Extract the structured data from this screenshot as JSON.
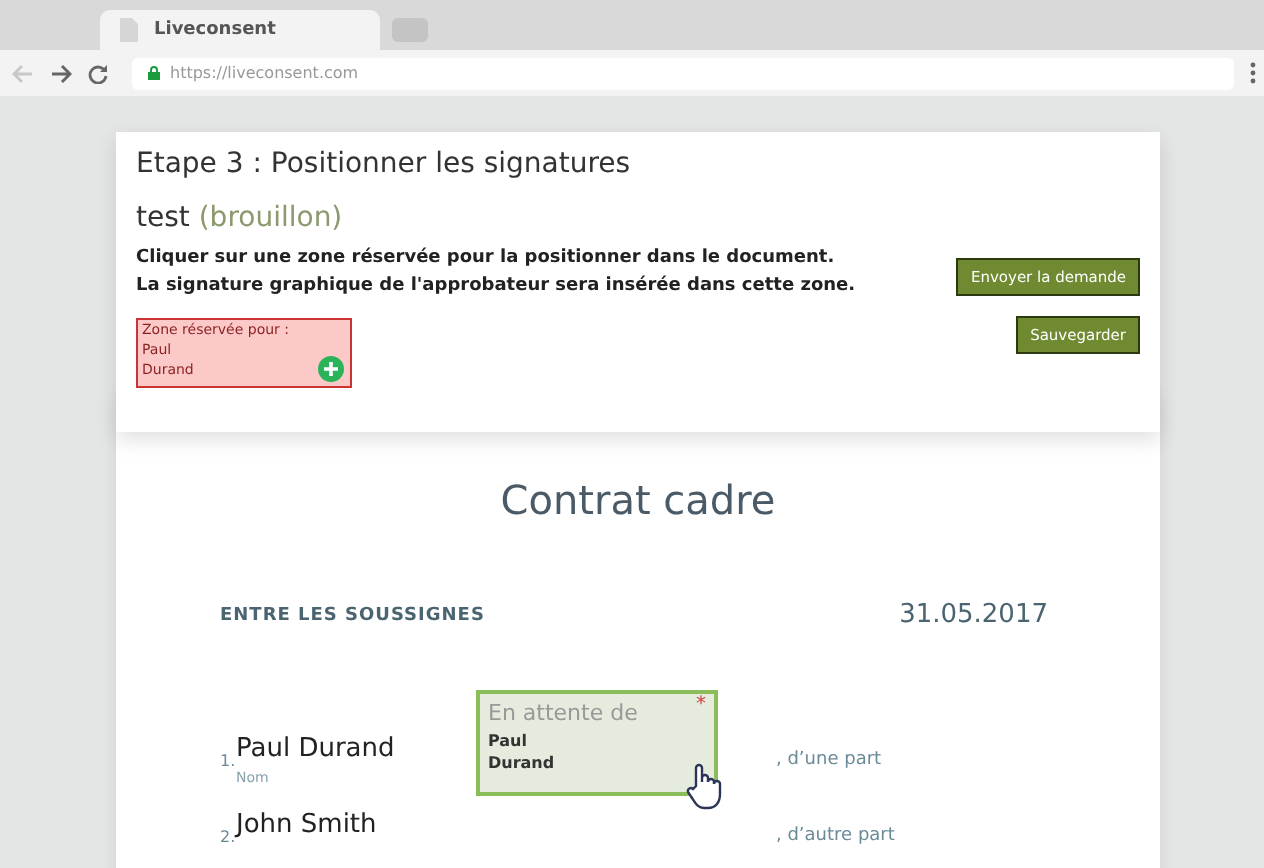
{
  "browser": {
    "tab_title": "Liveconsent",
    "url": "https://liveconsent.com"
  },
  "panel": {
    "title": "Etape 3 : Positionner les signatures",
    "doc_name": "test",
    "status": "(brouillon)",
    "instructions": [
      "Cliquer sur une zone réservée pour la positionner dans le document.",
      "La signature graphique de l'approbateur sera insérée dans cette zone."
    ],
    "zone": {
      "label": "Zone réservée pour :",
      "first_name": "Paul",
      "last_name": "Durand"
    },
    "buttons": [
      "Envoyer la demande",
      "Sauvegarder"
    ]
  },
  "document": {
    "title": "Contrat cadre",
    "section": "ENTRE LES SOUSSIGNES",
    "date": "31.05.2017",
    "parties": [
      {
        "number": "1.",
        "name": "Paul Durand",
        "sublabel": "Nom",
        "suffix": ", d’une part"
      },
      {
        "number": "2.",
        "name": "John Smith",
        "suffix": ", d’autre part"
      }
    ],
    "placed_zone": {
      "label": "En attente de",
      "first_name": "Paul",
      "last_name": "Durand",
      "required_mark": "*"
    }
  }
}
